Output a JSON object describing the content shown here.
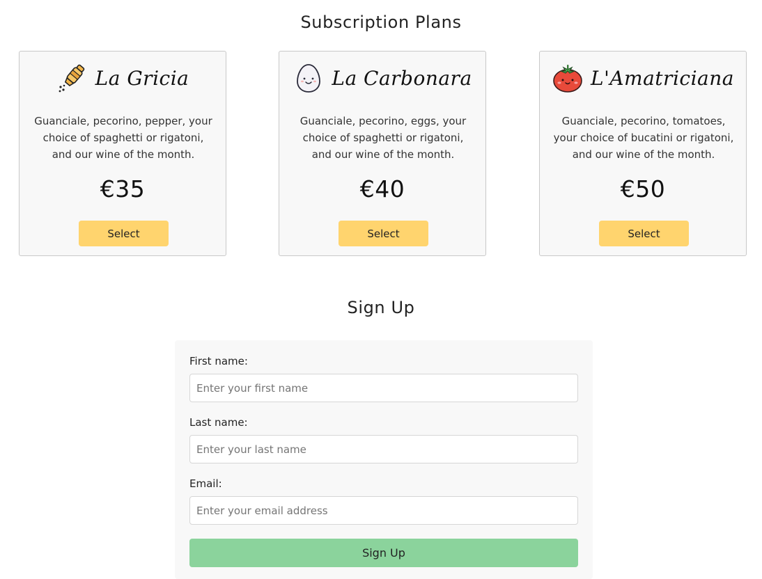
{
  "subscription": {
    "title": "Subscription Plans",
    "plans": [
      {
        "name": "La Gricia",
        "icon": "pepper-grinder-icon",
        "description": "Guanciale, pecorino, pepper, your choice of spaghetti or rigatoni, and our wine of the month.",
        "price": "€35",
        "button_label": "Select"
      },
      {
        "name": "La Carbonara",
        "icon": "egg-icon",
        "description": "Guanciale, pecorino, eggs, your choice of spaghetti or rigatoni, and our wine of the month.",
        "price": "€40",
        "button_label": "Select"
      },
      {
        "name": "L'Amatriciana",
        "icon": "tomato-icon",
        "description": "Guanciale, pecorino, tomatoes, your choice of bucatini or rigatoni, and our wine of the month.",
        "price": "€50",
        "button_label": "Select"
      }
    ]
  },
  "signup": {
    "title": "Sign Up",
    "first_name": {
      "label": "First name:",
      "placeholder": "Enter your first name",
      "value": ""
    },
    "last_name": {
      "label": "Last name:",
      "placeholder": "Enter your last name",
      "value": ""
    },
    "email": {
      "label": "Email:",
      "placeholder": "Enter your email address",
      "value": ""
    },
    "submit_label": "Sign Up"
  },
  "colors": {
    "select_button": "#ffd46e",
    "signup_button": "#8bd39c",
    "card_background": "#f8f8f8"
  }
}
